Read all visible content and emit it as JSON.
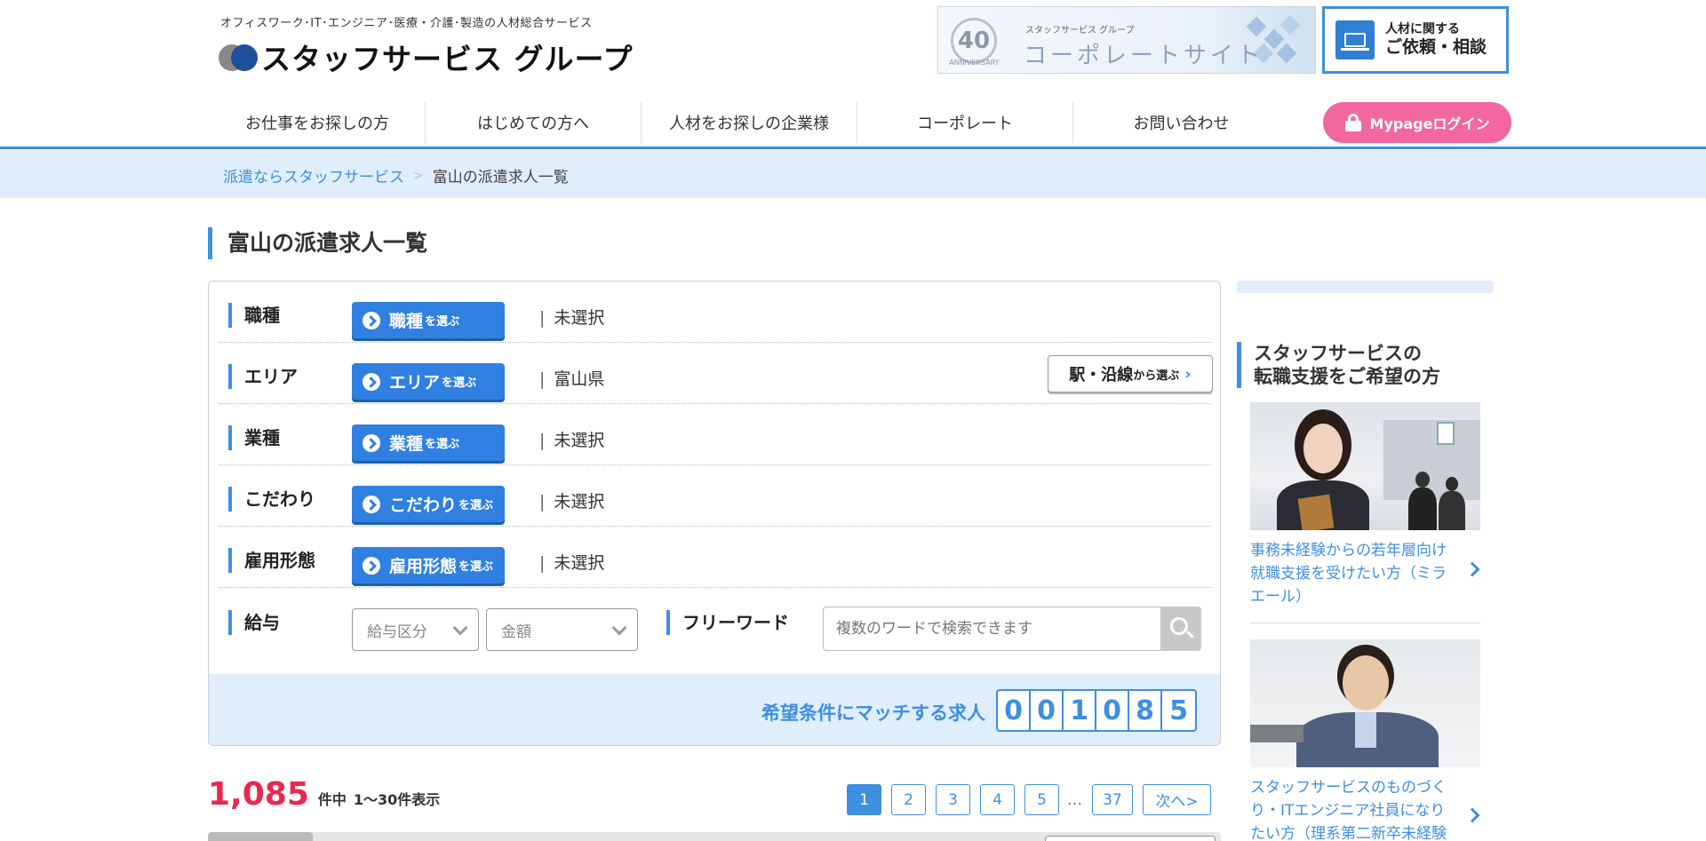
{
  "header": {
    "tagline": "オフィスワーク･IT･エンジニア･医療・介護･製造の人材総合サービス",
    "logo_text": "スタッフサービス グループ",
    "corporate_banner": {
      "badge": "40",
      "anniversary": "ANNIVERSARY",
      "group": "スタッフサービス グループ",
      "title": "コーポレートサイト"
    },
    "consult": {
      "line1": "人材に関する",
      "line2": "ご依頼・相談"
    }
  },
  "nav": {
    "items": [
      {
        "label": "お仕事をお探しの方"
      },
      {
        "label": "はじめての方へ"
      },
      {
        "label": "人材をお探しの企業様"
      },
      {
        "label": "コーポレート"
      },
      {
        "label": "お問い合わせ"
      }
    ],
    "login_label": "Mypageログイン"
  },
  "breadcrumb": {
    "home": "派遣ならスタッフサービス",
    "separator": ">",
    "current": "富山の派遣求人一覧"
  },
  "page_title": "富山の派遣求人一覧",
  "search": {
    "rows": [
      {
        "label": "職種",
        "button_main": "職種",
        "button_suffix": "を選ぶ",
        "value": "未選択"
      },
      {
        "label": "エリア",
        "button_main": "エリア",
        "button_suffix": "を選ぶ",
        "value": "富山県"
      },
      {
        "label": "業種",
        "button_main": "業種",
        "button_suffix": "を選ぶ",
        "value": "未選択"
      },
      {
        "label": "こだわり",
        "button_main": "こだわり",
        "button_suffix": "を選ぶ",
        "value": "未選択"
      },
      {
        "label": "雇用形態",
        "button_main": "雇用形態",
        "button_suffix": "を選ぶ",
        "value": "未選択"
      }
    ],
    "value_separator": "|",
    "station_button": {
      "main": "駅・沿線",
      "suffix": "から選ぶ",
      "arrow": "›"
    },
    "salary_label": "給与",
    "salary_type_placeholder": "給与区分",
    "salary_amount_placeholder": "金額",
    "freeword_label": "フリーワード",
    "freeword_placeholder": "複数のワードで検索できます",
    "match_text": "希望条件にマッチする求人",
    "match_digits": [
      "0",
      "0",
      "1",
      "0",
      "8",
      "5"
    ]
  },
  "results": {
    "total": "1,085",
    "unit": "件中",
    "range": "1〜30件表示"
  },
  "pagination": {
    "pages": [
      "1",
      "2",
      "3",
      "4",
      "5"
    ],
    "ellipsis": "…",
    "last": "37",
    "next": "次へ>",
    "current": "1"
  },
  "sidebar": {
    "heading_line1": "スタッフサービスの",
    "heading_line2": "転職支援をご希望の方",
    "cards": [
      {
        "text": "事務未経験からの若年層向け就職支援を受けたい方（ミラエール）"
      },
      {
        "text": "スタッフサービスのものづくり・ITエンジニア社員になりたい方（理系第二新卒未経験"
      }
    ]
  },
  "colors": {
    "accent": "#3e8fe0",
    "login": "#f2679d",
    "count": "#e8284f",
    "light_bg": "#e0edfb"
  }
}
